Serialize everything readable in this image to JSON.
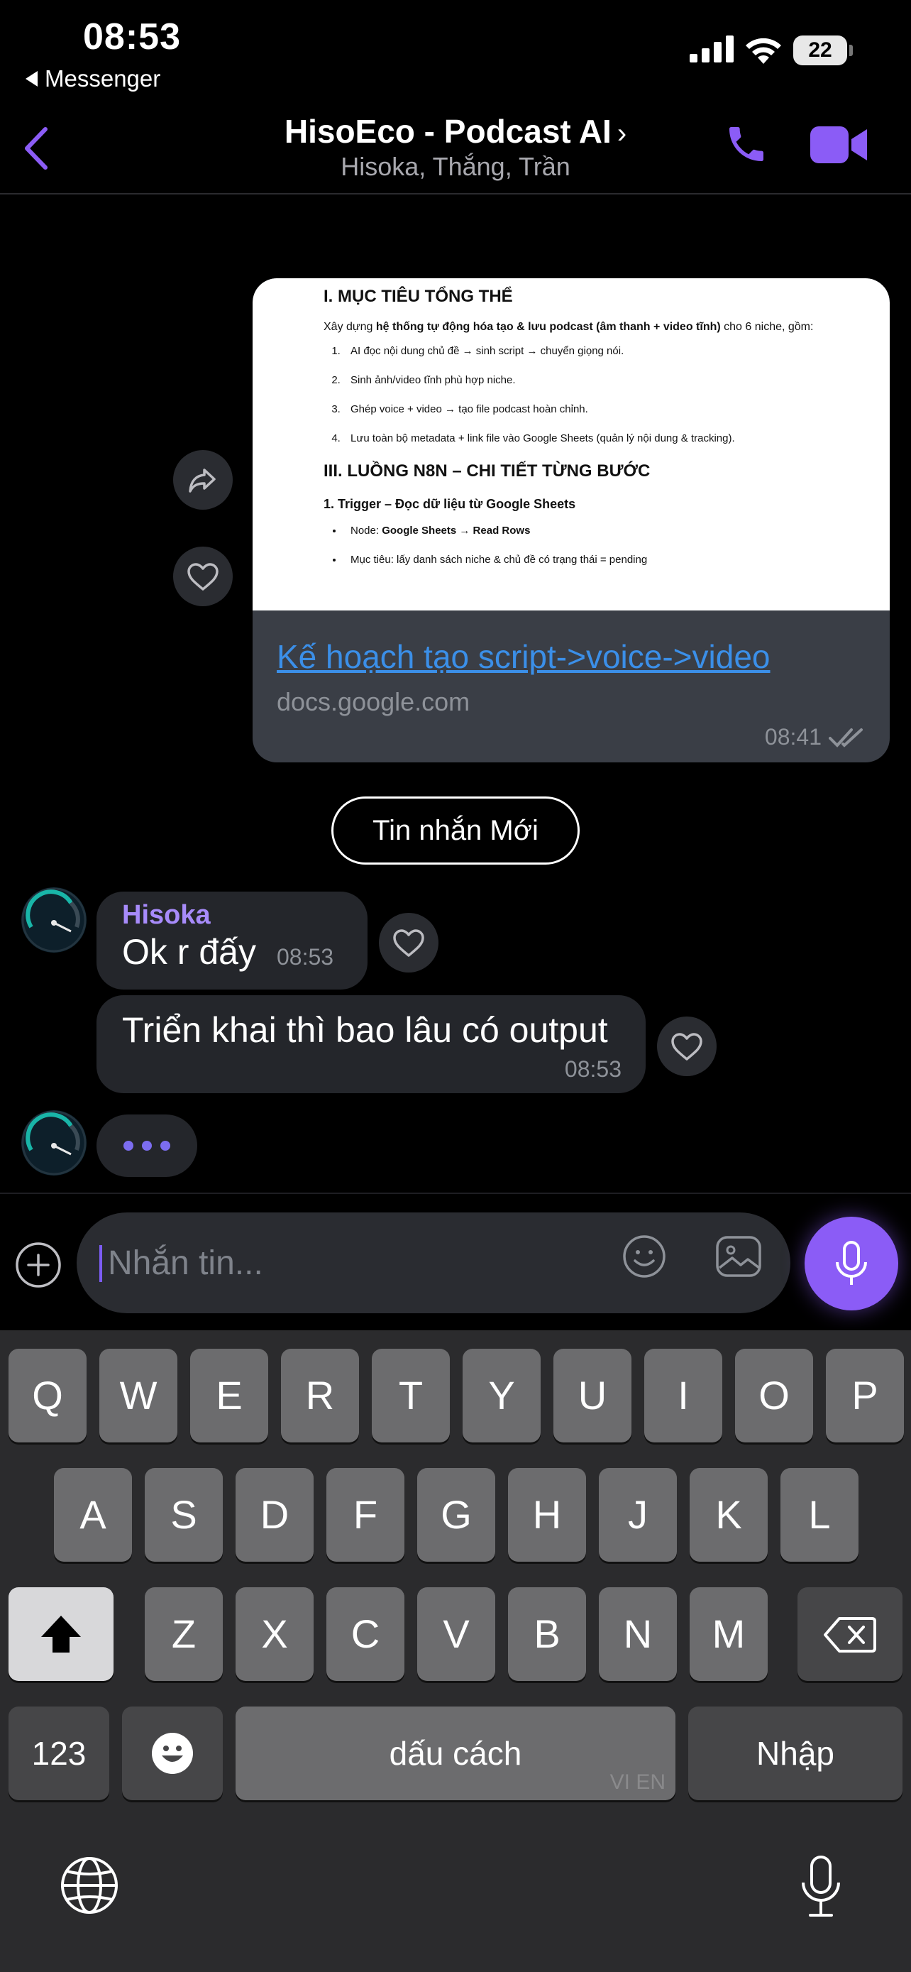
{
  "status_bar": {
    "time": "08:53",
    "back_app": "Messenger",
    "battery": "22"
  },
  "header": {
    "title": "HisoEco - Podcast AI",
    "chevron": "›",
    "subtitle": "Hisoka, Thắng, Trần",
    "icons": [
      "back-chevron-icon",
      "phone-icon",
      "video-call-icon"
    ],
    "accent_color": "#8b5cf6"
  },
  "link_card": {
    "doc_preview": {
      "heading1": "I. MỤC TIÊU TỔNG THỂ",
      "intro_pre": "Xây dựng ",
      "intro_bold": "hệ thống tự động hóa tạo & lưu podcast (âm thanh + video tĩnh)",
      "intro_post": " cho 6 niche, gồm:",
      "steps": [
        "AI đọc nội dung chủ đề → sinh script → chuyển giọng nói.",
        "Sinh ảnh/video tĩnh phù hợp niche.",
        "Ghép voice + video → tạo file podcast hoàn chỉnh.",
        "Lưu toàn bộ metadata + link file vào Google Sheets (quản lý nội dung & tracking)."
      ],
      "heading2": "III. LUỒNG N8N – CHI TIẾT TỪNG BƯỚC",
      "heading3": "1. Trigger – Đọc dữ liệu từ Google Sheets",
      "bullet1_pre": "Node: ",
      "bullet1_bold": "Google Sheets → Read Rows",
      "bullet2": "Mục tiêu: lấy danh sách niche & chủ đề có trạng thái = pending"
    },
    "title": "Kế hoạch tạo script->voice->video",
    "domain": "docs.google.com",
    "time": "08:41"
  },
  "new_messages_label": "Tin nhắn Mới",
  "messages": [
    {
      "sender": "Hisoka",
      "text": "Ok r đấy",
      "time": "08:53"
    },
    {
      "text": "Triển khai thì bao lâu có output",
      "time": "08:53"
    }
  ],
  "composer": {
    "placeholder": "Nhắn tin..."
  },
  "keyboard": {
    "row1": [
      "Q",
      "W",
      "E",
      "R",
      "T",
      "Y",
      "U",
      "I",
      "O",
      "P"
    ],
    "row2": [
      "A",
      "S",
      "D",
      "F",
      "G",
      "H",
      "J",
      "K",
      "L"
    ],
    "row3": [
      "Z",
      "X",
      "C",
      "V",
      "B",
      "N",
      "M"
    ],
    "numbers": "123",
    "space": "dấu cách",
    "space_hint": "VI EN",
    "return": "Nhập"
  }
}
